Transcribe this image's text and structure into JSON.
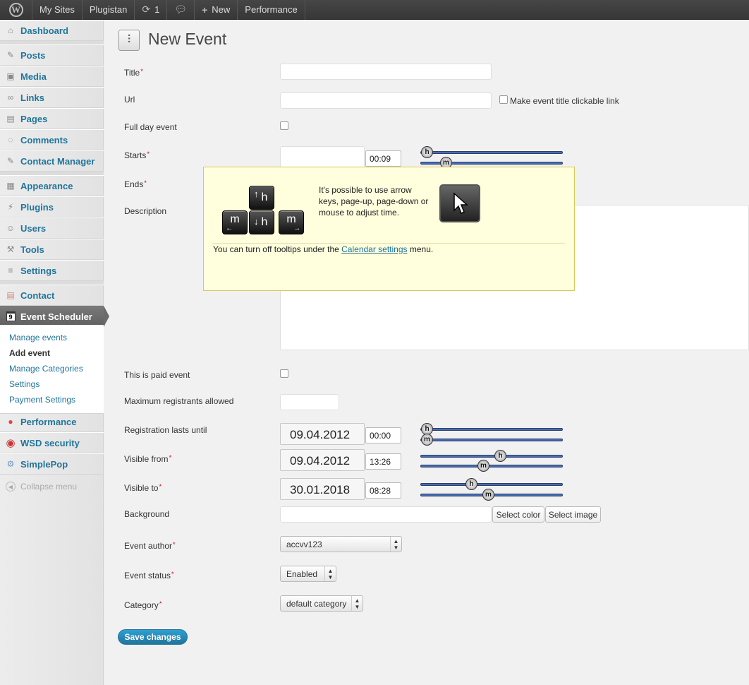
{
  "adminbar": {
    "my_sites": "My Sites",
    "site_name": "Plugistan",
    "updates_count": "1",
    "new_label": "New",
    "performance": "Performance"
  },
  "sidebar": {
    "items": [
      {
        "label": "Dashboard",
        "icon": "home-icon"
      },
      {
        "label": "Posts",
        "icon": "pin-icon"
      },
      {
        "label": "Media",
        "icon": "media-icon"
      },
      {
        "label": "Links",
        "icon": "link-icon"
      },
      {
        "label": "Pages",
        "icon": "page-icon"
      },
      {
        "label": "Comments",
        "icon": "comment-icon"
      },
      {
        "label": "Contact Manager",
        "icon": "pin-icon"
      },
      {
        "label": "Appearance",
        "icon": "appearance-icon"
      },
      {
        "label": "Plugins",
        "icon": "plug-icon"
      },
      {
        "label": "Users",
        "icon": "users-icon"
      },
      {
        "label": "Tools",
        "icon": "tools-icon"
      },
      {
        "label": "Settings",
        "icon": "settings-icon"
      },
      {
        "label": "Contact",
        "icon": "contact-icon"
      },
      {
        "label": "Event Scheduler",
        "icon": "calendar-icon",
        "icon_text": "9"
      },
      {
        "label": "Performance",
        "icon": "performance-icon"
      },
      {
        "label": "WSD security",
        "icon": "security-icon"
      },
      {
        "label": "SimplePop",
        "icon": "gear-icon"
      },
      {
        "label": "Collapse menu",
        "icon": "collapse-icon"
      }
    ],
    "submenu": [
      {
        "label": "Manage events"
      },
      {
        "label": "Add event"
      },
      {
        "label": "Manage Categories"
      },
      {
        "label": "Settings"
      },
      {
        "label": "Payment Settings"
      }
    ]
  },
  "page": {
    "title": "New Event"
  },
  "form": {
    "title_label": "Title",
    "url_label": "Url",
    "clickable_link_label": "Make event title clickable link",
    "full_day_label": "Full day event",
    "starts_label": "Starts",
    "starts_time": "00:09",
    "ends_label": "Ends",
    "description_label": "Description",
    "paid_label": "This is paid event",
    "max_reg_label": "Maximum registrants allowed",
    "reg_until_label": "Registration lasts until",
    "reg_until_date": "09.04.2012",
    "reg_until_time": "00:00",
    "visible_from_label": "Visible from",
    "visible_from_date": "09.04.2012",
    "visible_from_time": "13:26",
    "visible_to_label": "Visible to",
    "visible_to_date": "30.01.2018",
    "visible_to_time": "08:28",
    "background_label": "Background",
    "select_color": "Select color",
    "select_image": "Select image",
    "author_label": "Event author",
    "author_value": "accvv123",
    "status_label": "Event status",
    "status_value": "Enabled",
    "category_label": "Category",
    "category_value": "default category",
    "save_label": "Save changes",
    "hour_handle": "h",
    "minute_handle": "m",
    "required_mark": "*"
  },
  "tooltip": {
    "text": "It's possible to use arrow keys, page-up, page-down or mouse to adjust time.",
    "footer_before": "You can turn off tooltips under the ",
    "footer_link": "Calendar settings",
    "footer_after": " menu.",
    "key_up": "h",
    "key_down": "h",
    "key_left": "m",
    "key_right": "m"
  },
  "colors": {
    "link": "#21759b",
    "tooltip_bg": "#ffffdd",
    "slider": "#4a6db3"
  }
}
